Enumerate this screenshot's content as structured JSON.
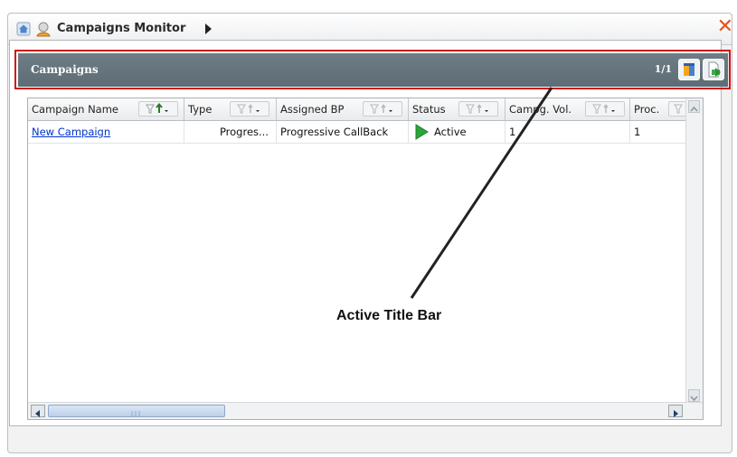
{
  "app": {
    "title": "Campaigns Monitor"
  },
  "panel": {
    "title": "Campaigns",
    "page_count": "1/1",
    "buttons": [
      "columns-icon",
      "export-icon"
    ]
  },
  "grid": {
    "columns": [
      {
        "label": "Campaign Name"
      },
      {
        "label": "Type"
      },
      {
        "label": "Assigned BP"
      },
      {
        "label": "Status"
      },
      {
        "label": "Campg. Vol."
      },
      {
        "label": "Proc."
      }
    ],
    "rows": [
      {
        "campaign_name": "New Campaign",
        "type": "Progres...",
        "assigned_bp": "Progressive CallBack",
        "status": "Active",
        "campg_vol": "1",
        "proc": "1"
      }
    ]
  },
  "annotation": {
    "label": "Active Title Bar"
  },
  "colors": {
    "title_bar": "#627079",
    "highlight": "#cc1414",
    "close": "#e8531a",
    "status_active": "#2aa53a"
  }
}
